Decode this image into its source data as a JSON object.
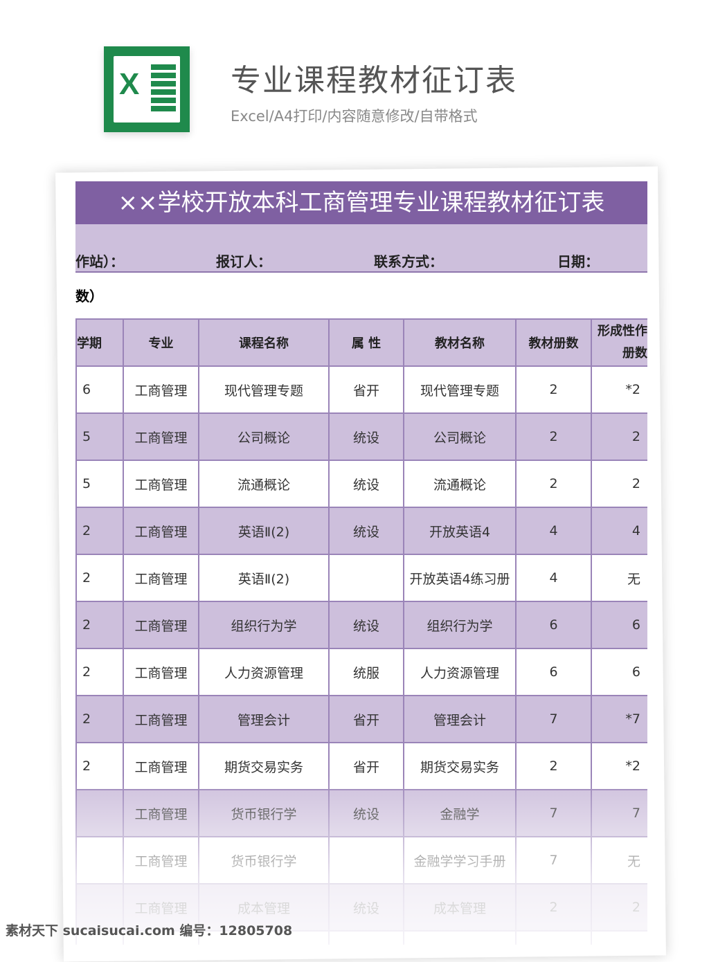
{
  "header": {
    "title": "专业课程教材征订表",
    "subtitle": "Excel/A4打印/内容随意修改/自带格式",
    "icon": "excel-icon",
    "icon_letter": "X"
  },
  "sheet": {
    "title": "××学校开放本科工商管理专业课程教材征订表",
    "info": [
      "作站）：",
      "报订人：",
      "联系方式：",
      "日期："
    ],
    "note": "数）",
    "columns": [
      "学期",
      "专业",
      "课程名称",
      "属 性",
      "教材名称",
      "教材册数",
      "形成性作册数"
    ],
    "rows": [
      [
        "6",
        "工商管理",
        "现代管理专题",
        "省开",
        "现代管理专题",
        "2",
        "*2"
      ],
      [
        "5",
        "工商管理",
        "公司概论",
        "统设",
        "公司概论",
        "2",
        "2"
      ],
      [
        "5",
        "工商管理",
        "流通概论",
        "统设",
        "流通概论",
        "2",
        "2"
      ],
      [
        "2",
        "工商管理",
        "英语Ⅱ(2)",
        "统设",
        "开放英语4",
        "4",
        "4"
      ],
      [
        "2",
        "工商管理",
        "英语Ⅱ(2)",
        "",
        "开放英语4练习册",
        "4",
        "无"
      ],
      [
        "2",
        "工商管理",
        "组织行为学",
        "统设",
        "组织行为学",
        "6",
        "6"
      ],
      [
        "2",
        "工商管理",
        "人力资源管理",
        "统服",
        "人力资源管理",
        "6",
        "6"
      ],
      [
        "2",
        "工商管理",
        "管理会计",
        "省开",
        "管理会计",
        "7",
        "*7"
      ],
      [
        "2",
        "工商管理",
        "期货交易实务",
        "省开",
        "期货交易实务",
        "2",
        "*2"
      ],
      [
        "",
        "工商管理",
        "货币银行学",
        "统设",
        "金融学",
        "7",
        "7"
      ],
      [
        "",
        "工商管理",
        "货币银行学",
        "",
        "金融学学习手册",
        "7",
        "无"
      ],
      [
        "",
        "工商管理",
        "成本管理",
        "统设",
        "成本管理",
        "2",
        "2"
      ],
      [
        "",
        "",
        "",
        "",
        "",
        "",
        ""
      ]
    ]
  },
  "colors": {
    "banner": "#7f60a2",
    "band": "#cdbfdc",
    "excel_green": "#1f8a4c"
  },
  "watermark": "素材天下 sucaisucai.com  编号：12805708"
}
